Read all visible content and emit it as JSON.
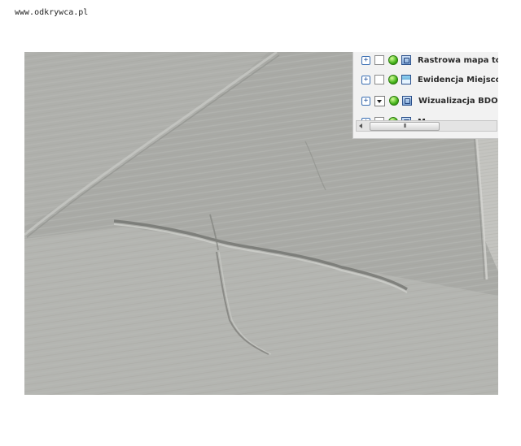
{
  "site": {
    "url": "www.odkrywca.pl"
  },
  "layer_panel": {
    "layers": [
      {
        "label": "Rastrowa mapa topo",
        "checked": false,
        "status": "active",
        "icon": "layer-icon"
      },
      {
        "label": "Ewidencja Miejscowo",
        "checked": false,
        "status": "active",
        "icon": "wms-layer-icon"
      },
      {
        "label": "Wizualizacja BDO",
        "checked": true,
        "status": "active",
        "icon": "layer-icon"
      },
      {
        "label": "M",
        "checked": false,
        "status": "active",
        "icon": "layer-icon"
      }
    ],
    "scrollbar": {
      "thumb_glyph": "III"
    }
  },
  "colors": {
    "terrain_base": "#a9aaa6",
    "panel_bg": "#f2f2f2",
    "status_green": "#44b31a",
    "expander_blue": "#3b6fb3"
  }
}
